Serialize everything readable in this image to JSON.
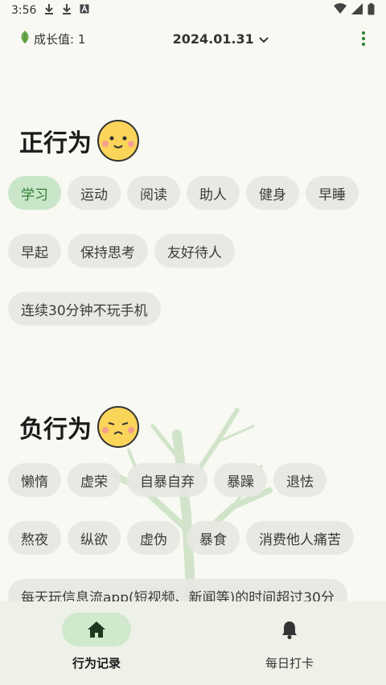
{
  "status_bar": {
    "time": "3:56"
  },
  "header": {
    "growth_label": "成长值: 1",
    "date": "2024.01.31"
  },
  "positive": {
    "title": "正行为",
    "rows": [
      [
        "学习",
        "运动",
        "阅读",
        "助人",
        "健身",
        "早睡"
      ],
      [
        "早起",
        "保持思考",
        "友好待人"
      ],
      [
        "连续30分钟不玩手机"
      ]
    ],
    "selected": "学习"
  },
  "negative": {
    "title": "负行为",
    "rows": [
      [
        "懒惰",
        "虚荣",
        "自暴自弃",
        "暴躁",
        "退怯"
      ],
      [
        "熬夜",
        "纵欲",
        "虚伪",
        "暴食",
        "消费他人痛苦"
      ],
      [
        "每天玩信息流app(短视频、新闻等)的时间超过30分"
      ]
    ]
  },
  "colors": {
    "accent": "#2e7d32",
    "selected_chip": "#c9e6c9",
    "chip": "#e7e7e3",
    "background": "#f8f9f3",
    "nav_background": "#edf1e8"
  },
  "bottom_nav": {
    "items": [
      {
        "label": "行为记录",
        "icon": "home-icon",
        "active": true
      },
      {
        "label": "每日打卡",
        "icon": "bell-icon",
        "active": false
      }
    ]
  }
}
